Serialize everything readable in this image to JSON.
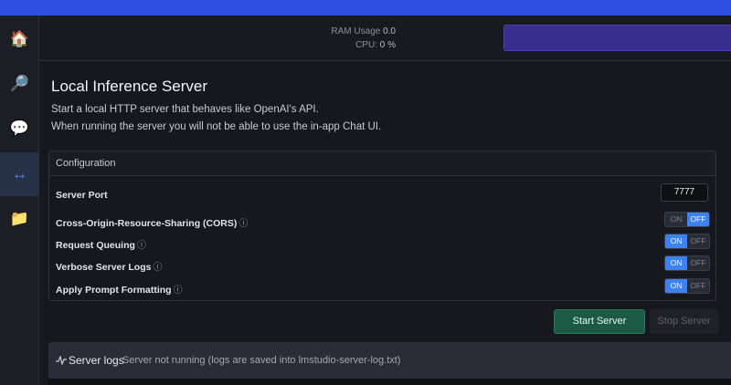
{
  "sidebar": {
    "items": [
      {
        "icon": "home-icon",
        "glyph": "🏠"
      },
      {
        "icon": "search-icon",
        "glyph": "🔎"
      },
      {
        "icon": "chat-icon",
        "glyph": "💬"
      },
      {
        "icon": "server-icon",
        "glyph": "↔"
      },
      {
        "icon": "folder-icon",
        "glyph": "📁"
      }
    ]
  },
  "header": {
    "ram_label": "RAM Usage",
    "ram_value": "0.0",
    "cpu_label": "CPU:",
    "cpu_value": "0 %"
  },
  "main": {
    "title": "Local Inference Server",
    "desc_line1": "Start a local HTTP server that behaves like OpenAI's API.",
    "desc_line2": "When running the server you will not be able to use the in-app Chat UI."
  },
  "config": {
    "title": "Configuration",
    "port_label": "Server Port",
    "port_value": "7777",
    "info_glyph": "ⓘ",
    "toggle_on": "ON",
    "toggle_off": "OFF",
    "cors_label": "Cross-Origin-Resource-Sharing (CORS)",
    "cors_enabled": false,
    "queue_label": "Request Queuing",
    "queue_enabled": true,
    "verbose_label": "Verbose Server Logs",
    "verbose_enabled": true,
    "prompt_label": "Apply Prompt Formatting",
    "prompt_enabled": true
  },
  "actions": {
    "start_label": "Start Server",
    "stop_label": "Stop Server"
  },
  "logs": {
    "title": "Server logs",
    "status": "Server not running (logs are saved into lmstudio-server-log.txt)"
  },
  "colors": {
    "accent": "#2f4fe0",
    "toggle_on": "#3b82f6",
    "start_button": "#1c5a45"
  }
}
